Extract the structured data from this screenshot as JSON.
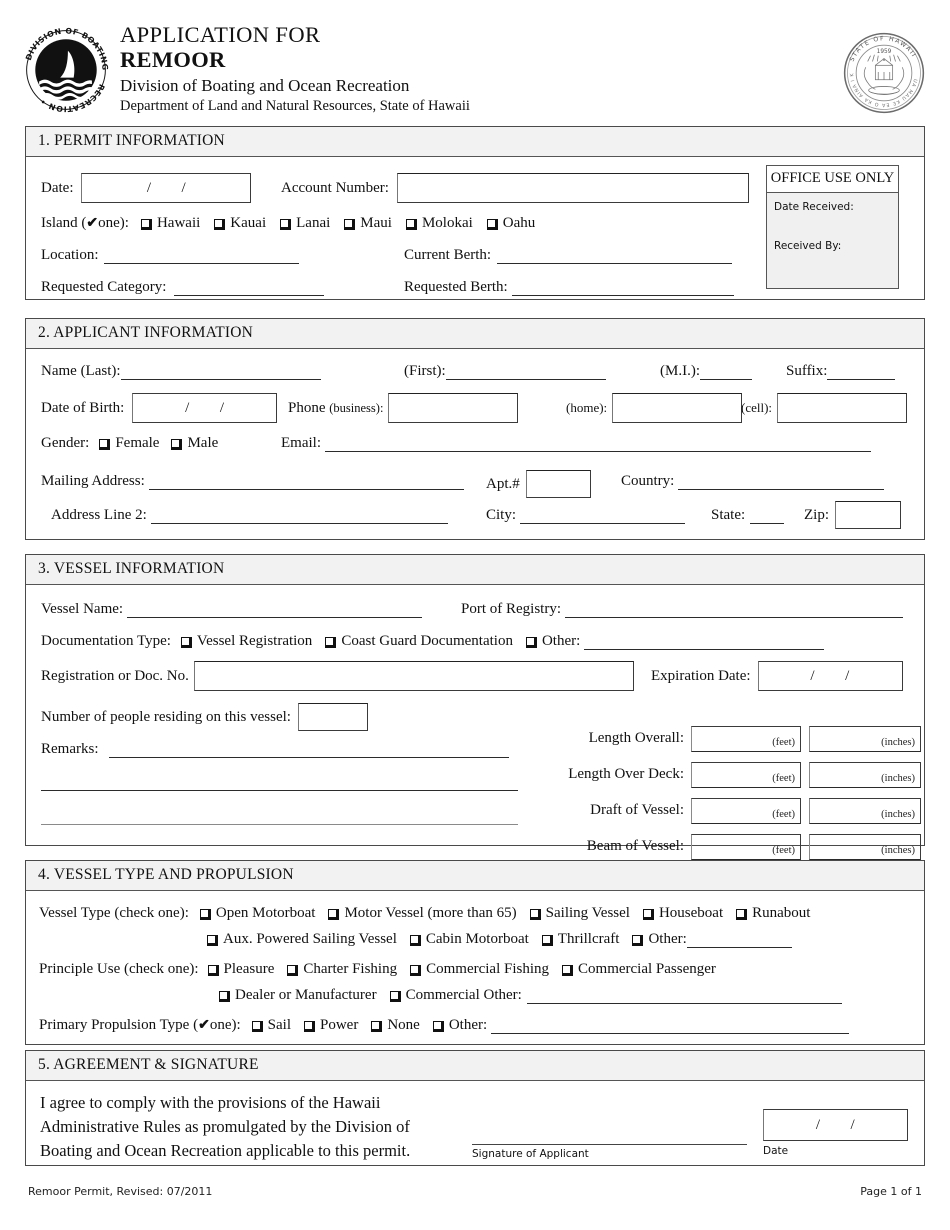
{
  "header": {
    "logo_alt": "Division of Boating and Ocean Recreation seal",
    "logo_ring_text": "DIVISION OF BOATING AND OCEAN RECREATION",
    "seal_alt": "State of Hawaii seal",
    "seal_ring_text": "STATE OF HAWAII",
    "seal_year": "1959",
    "title_line1": "APPLICATION FOR",
    "title_line2": "REMOOR",
    "title_line3": "Division of Boating and Ocean Recreation",
    "title_line4": "Department of Land and Natural Resources, State of Hawaii"
  },
  "section1": {
    "heading": "1. PERMIT INFORMATION",
    "date_label": "Date:",
    "date_slash": "/",
    "account_label": "Account Number:",
    "account_value": "",
    "island_label": "Island (",
    "island_check": "✔",
    "island_label_end": "one):",
    "islands": [
      "Hawaii",
      "Kauai",
      "Lanai",
      "Maui",
      "Molokai",
      "Oahu"
    ],
    "location_label": "Location:",
    "current_berth_label": "Current Berth:",
    "requested_category_label": "Requested Category:",
    "requested_berth_label": "Requested Berth:",
    "office": {
      "title": "OFFICE USE ONLY",
      "date_received_label": "Date Received:",
      "received_by_label": "Received By:"
    }
  },
  "section2": {
    "heading": "2. APPLICANT INFORMATION",
    "name_last_label": "Name (Last):",
    "name_first_label": "(First):",
    "name_mi_label": "(M.I.):",
    "suffix_label": "Suffix:",
    "dob_label": "Date of Birth:",
    "date_slash": "/",
    "phone_business_label": "Phone (business):",
    "phone_home_label": "(home):",
    "phone_cell_label": "(cell):",
    "gender_label": "Gender:",
    "gender_options": [
      "Female",
      "Male"
    ],
    "email_label": "Email:",
    "mailing_address_label": "Mailing Address:",
    "apt_label": "Apt.#",
    "country_label": "Country:",
    "address_line2_label": "Address Line 2:",
    "city_label": "City:",
    "state_label": "State:",
    "zip_label": "Zip:"
  },
  "section3": {
    "heading": "3. VESSEL INFORMATION",
    "vessel_name_label": "Vessel Name:",
    "port_of_registry_label": "Port of Registry:",
    "documentation_type_label": "Documentation Type:",
    "documentation_options": [
      "Vessel Registration",
      "Coast Guard Documentation",
      "Other:"
    ],
    "registration_label": "Registration or Doc. No.",
    "expiration_label": "Expiration Date:",
    "date_slash": "/",
    "people_label": "Number of people residing on this vessel:",
    "remarks_label": "Remarks:",
    "measurements": [
      {
        "label": "Length Overall:",
        "feet": "(feet)",
        "inches": "(inches)"
      },
      {
        "label": "Length Over Deck:",
        "feet": "(feet)",
        "inches": "(inches)"
      },
      {
        "label": "Draft of Vessel:",
        "feet": "(feet)",
        "inches": "(inches)"
      },
      {
        "label": "Beam of Vessel:",
        "feet": "(feet)",
        "inches": "(inches)"
      }
    ]
  },
  "section4": {
    "heading": "4. VESSEL TYPE AND PROPULSION",
    "vessel_type_label": "Vessel Type (check one):",
    "vessel_types_row1": [
      "Open Motorboat",
      "Motor Vessel (more than 65)",
      "Sailing Vessel",
      "Houseboat",
      "Runabout"
    ],
    "vessel_types_row2": [
      "Aux. Powered Sailing Vessel",
      "Cabin Motorboat",
      "Thrillcraft",
      "Other:"
    ],
    "principle_use_label": "Principle Use (check one):",
    "principle_use_row1": [
      "Pleasure",
      "Charter Fishing",
      "Commercial Fishing",
      "Commercial Passenger"
    ],
    "principle_use_row2": [
      "Dealer or Manufacturer",
      "Commercial Other:"
    ],
    "propulsion_label_start": "Primary Propulsion Type (",
    "propulsion_check": "✔",
    "propulsion_label_end": "one):",
    "propulsion_options": [
      "Sail",
      "Power",
      "None",
      "Other:"
    ]
  },
  "section5": {
    "heading": "5. AGREEMENT & SIGNATURE",
    "agreement_line1": "I agree to comply with the provisions of the Hawaii",
    "agreement_line2": "Administrative Rules as promulgated by the Division of",
    "agreement_line3": "Boating and Ocean Recreation applicable to this permit.",
    "signature_label": "Signature of Applicant",
    "date_label": "Date",
    "date_slash": "/"
  },
  "footer": {
    "left": "Remoor Permit, Revised: 07/2011",
    "right": "Page 1 of 1"
  }
}
